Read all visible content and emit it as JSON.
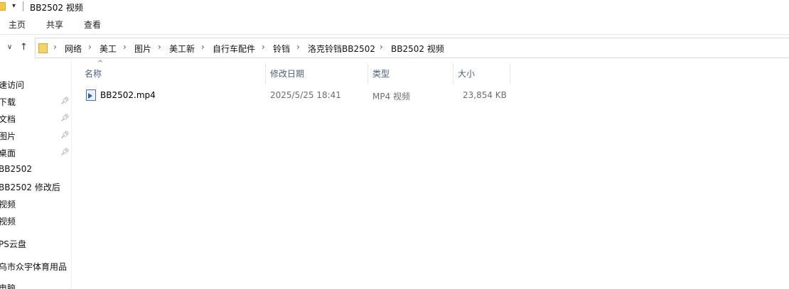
{
  "window": {
    "title": "BB2502 视频"
  },
  "ribbon": {
    "tabs": [
      "主页",
      "共享",
      "查看"
    ]
  },
  "navigation": {
    "breadcrumb": [
      "网络",
      "美工",
      "图片",
      "美工新",
      "自行车配件",
      "铃铛",
      "洛克铃铛BB2502",
      "BB2502 视频"
    ]
  },
  "sidebar": {
    "items": [
      {
        "label": "速访问",
        "pinned": false
      },
      {
        "label": "下载",
        "pinned": true
      },
      {
        "label": "文档",
        "pinned": true
      },
      {
        "label": "图片",
        "pinned": true
      },
      {
        "label": "桌面",
        "pinned": true
      },
      {
        "label": "BB2502",
        "pinned": false
      },
      {
        "label": "BB2502  修改后",
        "pinned": false
      },
      {
        "label": "视频",
        "pinned": false
      },
      {
        "label": "视频",
        "pinned": false
      },
      {
        "label": "PS云盘",
        "pinned": false
      },
      {
        "label": "乌市众宇体育用品",
        "pinned": false
      },
      {
        "label": "电脑",
        "pinned": false
      }
    ]
  },
  "file_list": {
    "columns": [
      "名称",
      "修改日期",
      "类型",
      "大小"
    ],
    "rows": [
      {
        "name": "BB2502.mp4",
        "modified": "2025/5/25 18:41",
        "type": "MP4 视频",
        "size": "23,854 KB"
      }
    ]
  }
}
